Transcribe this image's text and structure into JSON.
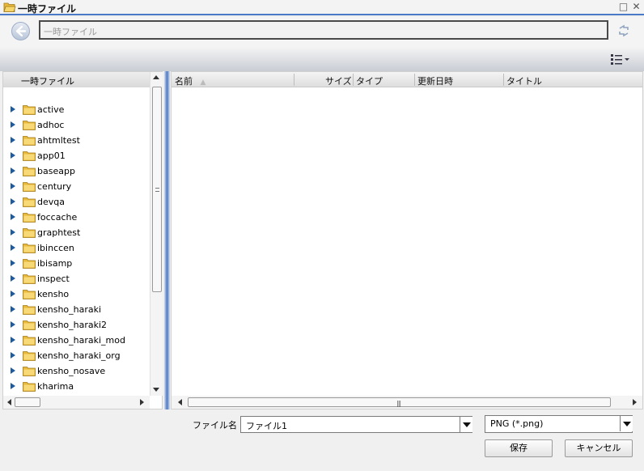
{
  "window": {
    "title": "一時ファイル"
  },
  "nav": {
    "path": "一時ファイル"
  },
  "left_pane": {
    "header": "一時ファイル",
    "folders": [
      "active",
      "adhoc",
      "ahtmltest",
      "app01",
      "baseapp",
      "century",
      "devqa",
      "foccache",
      "graphtest",
      "ibinccen",
      "ibisamp",
      "inspect",
      "kensho",
      "kensho_haraki",
      "kensho_haraki2",
      "kensho_haraki_mod",
      "kensho_haraki_org",
      "kensho_nosave",
      "kharima"
    ]
  },
  "columns": {
    "name": "名前",
    "size": "サイズ",
    "type": "タイプ",
    "modified": "更新日時",
    "title": "タイトル"
  },
  "form": {
    "filename_label": "ファイル名 :",
    "filename_value": "ファイル1",
    "filetype_value": "PNG (*.png)"
  },
  "buttons": {
    "save": "保存",
    "cancel": "キャンセル"
  },
  "colors": {
    "accent": "#4a79c7",
    "tree_arrow": "#1f5a9c",
    "folder": "#e8b93a"
  }
}
